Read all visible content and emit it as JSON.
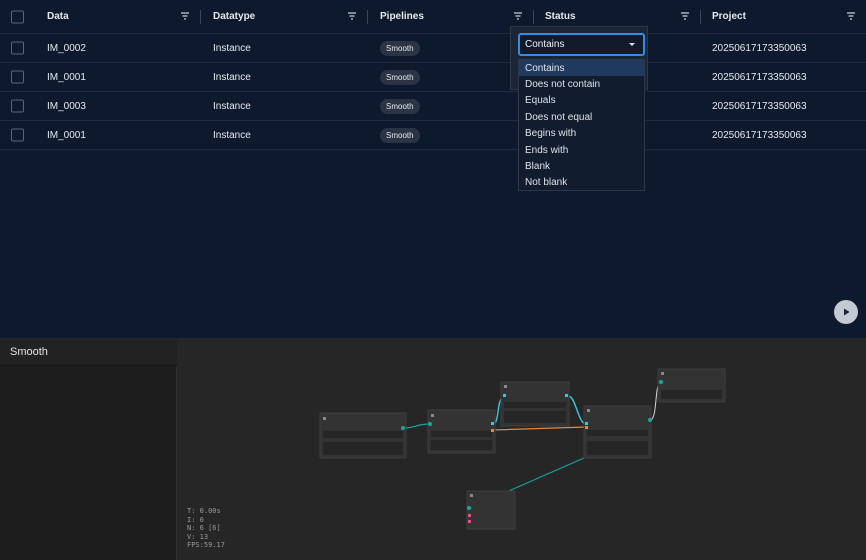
{
  "table": {
    "columns": [
      {
        "label": "Data"
      },
      {
        "label": "Datatype"
      },
      {
        "label": "Pipelines"
      },
      {
        "label": "Status"
      },
      {
        "label": "Project"
      }
    ],
    "rows": [
      {
        "data": "IM_0002",
        "datatype": "Instance",
        "pipeline": "Smooth",
        "project": "20250617173350063"
      },
      {
        "data": "IM_0001",
        "datatype": "Instance",
        "pipeline": "Smooth",
        "project": "20250617173350063"
      },
      {
        "data": "IM_0003",
        "datatype": "Instance",
        "pipeline": "Smooth",
        "project": "20250617173350063"
      },
      {
        "data": "IM_0001",
        "datatype": "Instance",
        "pipeline": "Smooth",
        "project": "20250617173350063"
      }
    ]
  },
  "filter": {
    "selected": "Contains",
    "options": [
      "Contains",
      "Does not contain",
      "Equals",
      "Does not equal",
      "Begins with",
      "Ends with",
      "Blank",
      "Not blank"
    ]
  },
  "editor": {
    "title": "Smooth",
    "stats": {
      "t": "T: 0.00s",
      "i": "I: 0",
      "n": "N: 6 [6]",
      "v": "V: 13",
      "fps": "FPS:59.17"
    }
  },
  "colors": {
    "accent": "#2f8fe6",
    "link_teal": "#1aa6a0",
    "link_cyan": "#38c6e6",
    "link_orange": "#e8893a"
  }
}
